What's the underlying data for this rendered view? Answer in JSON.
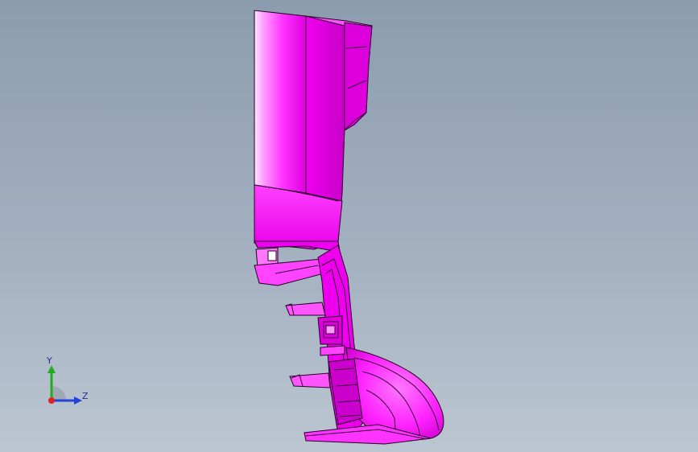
{
  "viewport": {
    "background_top": "#8c9caf",
    "background_bottom": "#bcc6d2"
  },
  "model": {
    "color": "#ff00ff",
    "highlight": "#ffd9ff",
    "shadow": "#b000b0",
    "edge": "#1a001a"
  },
  "triad": {
    "y_label": "Y",
    "z_label": "Z",
    "y_color": "#22aa22",
    "z_color": "#2244dd",
    "x_color": "#dd2222"
  }
}
